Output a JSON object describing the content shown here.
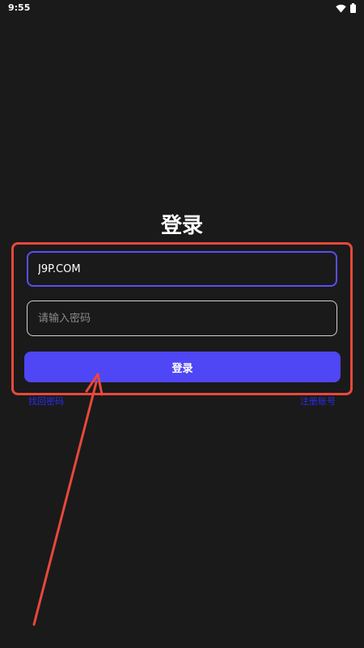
{
  "status_bar": {
    "time": "9:55",
    "icons": [
      "wifi-icon",
      "battery-icon"
    ]
  },
  "login": {
    "title": "登录",
    "username_value": "J9P.COM",
    "password_placeholder": "请输入密码",
    "submit_label": "登录",
    "forgot_password": "找回密码",
    "register": "注册账号"
  },
  "colors": {
    "background": "#1a1a1a",
    "accent": "#4f46f5",
    "focused_border": "#5a4ef7",
    "link": "#2c2cf0",
    "annotation": "#e8483b"
  }
}
